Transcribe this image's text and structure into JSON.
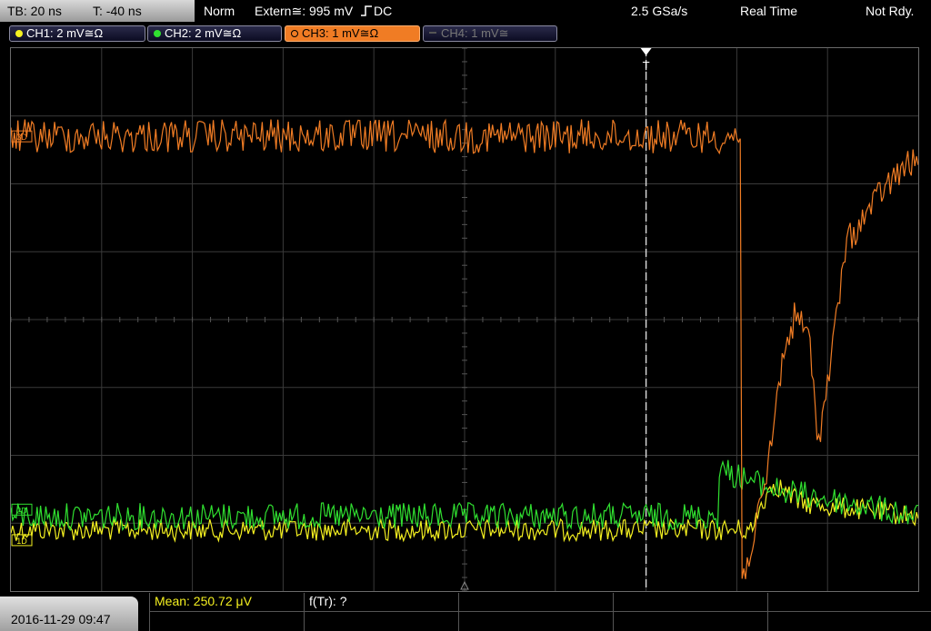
{
  "header": {
    "timebase": "TB: 20 ns",
    "trigger_offset": "T: -40 ns",
    "mode": "Norm",
    "trigger_source": "Extern≅: 995 mV",
    "trigger_edge": "DC",
    "sample_rate": "2.5 GSa/s",
    "acq_mode": "Real Time",
    "status": "Not Rdy."
  },
  "channels": [
    {
      "label": "CH1: 2 mV≅Ω",
      "color": "#f4f020",
      "active": false,
      "enabled": true
    },
    {
      "label": "CH2: 2 mV≅Ω",
      "color": "#30e030",
      "active": false,
      "enabled": true
    },
    {
      "label": "CH3: 1 mV≅Ω",
      "color": "#f07c24",
      "active": true,
      "enabled": true
    },
    {
      "label": "CH4: 1 mV≅",
      "color": "#555555",
      "active": false,
      "enabled": false
    }
  ],
  "markers": {
    "ch1": "1D",
    "ch2": "2D",
    "ch3": "3D",
    "trigger": "T"
  },
  "footer": {
    "datetime": "2016-11-29 09:47",
    "mean_label": "Mean: 250.72 μV",
    "freq_label": "f(Tr): ?"
  },
  "waveform_data": {
    "grid_divisions": {
      "x": 10,
      "y": 8
    },
    "trigger_time_div": 7.0,
    "ch3": {
      "color": "#f07c24",
      "baseline_div": 1.3,
      "noise_div": 0.25,
      "drop_time_div": 8.05,
      "recovery": [
        [
          8.05,
          7.9
        ],
        [
          8.3,
          6.6
        ],
        [
          8.5,
          4.6
        ],
        [
          8.65,
          3.9
        ],
        [
          8.8,
          4.3
        ],
        [
          8.9,
          5.8
        ],
        [
          9.05,
          4.5
        ],
        [
          9.2,
          2.9
        ],
        [
          9.6,
          2.1
        ],
        [
          9.9,
          1.7
        ],
        [
          10.0,
          1.7
        ]
      ]
    },
    "ch2": {
      "color": "#30e030",
      "baseline_div": 6.9,
      "noise_div": 0.2,
      "bump": [
        [
          7.8,
          6.2
        ],
        [
          8.4,
          6.5
        ],
        [
          10.0,
          6.9
        ]
      ]
    },
    "ch1": {
      "color": "#f4f020",
      "baseline_div": 7.1,
      "noise_div": 0.16,
      "bump": [
        [
          8.2,
          6.9
        ],
        [
          8.4,
          6.4
        ],
        [
          8.7,
          6.7
        ],
        [
          10.0,
          6.9
        ]
      ]
    }
  }
}
